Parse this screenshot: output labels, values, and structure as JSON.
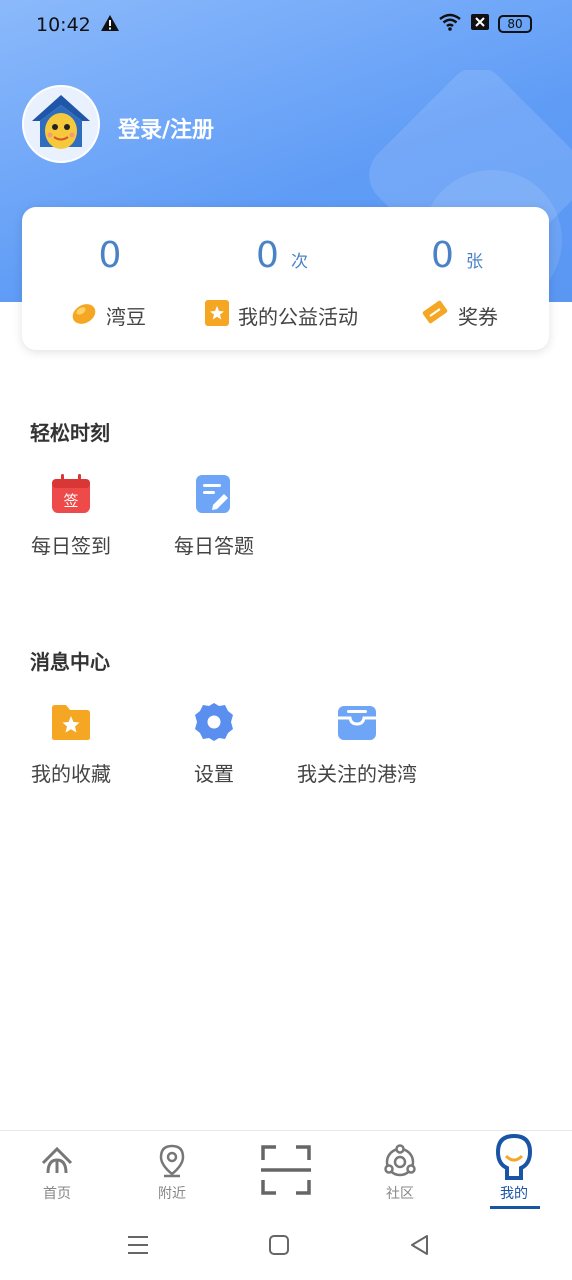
{
  "status_bar": {
    "time": "10:42",
    "battery": "80"
  },
  "header": {
    "login_label": "登录/注册"
  },
  "stats": [
    {
      "value": "0",
      "unit": "",
      "label": "湾豆"
    },
    {
      "value": "0",
      "unit": "次",
      "label": "我的公益活动"
    },
    {
      "value": "0",
      "unit": "张",
      "label": "奖券"
    }
  ],
  "sections": [
    {
      "title": "轻松时刻",
      "items": [
        {
          "label": "每日签到",
          "icon": "calendar-sign-icon"
        },
        {
          "label": "每日答题",
          "icon": "edit-note-icon"
        }
      ]
    },
    {
      "title": "消息中心",
      "items": [
        {
          "label": "我的收藏",
          "icon": "star-folder-icon"
        },
        {
          "label": "设置",
          "icon": "gear-icon"
        },
        {
          "label": "我关注的港湾",
          "icon": "inbox-icon"
        }
      ]
    }
  ],
  "signin_icon_text": "签",
  "tabs": [
    {
      "label": "首页",
      "icon": "home-icon"
    },
    {
      "label": "附近",
      "icon": "location-pin-icon"
    },
    {
      "label": "",
      "icon": "scan-icon"
    },
    {
      "label": "社区",
      "icon": "community-icon"
    },
    {
      "label": "我的",
      "icon": "mascot-icon",
      "active": true
    }
  ],
  "colors": {
    "accent": "#5f9cf6",
    "active_tab": "#1a55a5",
    "stat_number": "#4a82c6"
  }
}
